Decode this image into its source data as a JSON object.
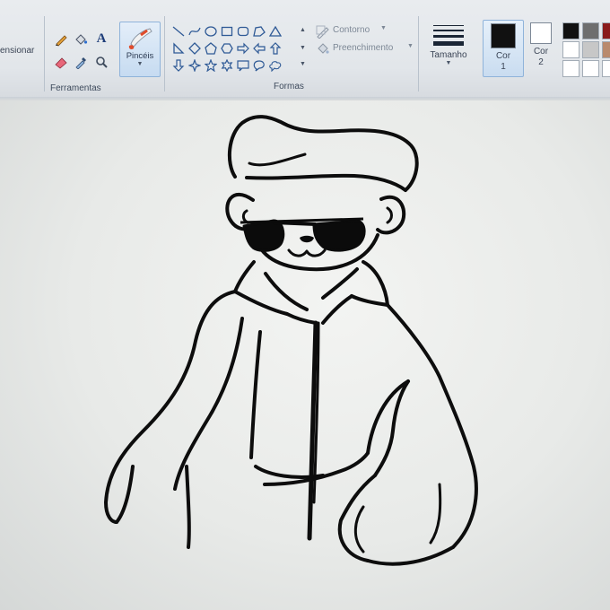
{
  "ribbon": {
    "selection_label": "ensionar",
    "tools_group_label": "Ferramentas",
    "brushes_label": "Pincéis",
    "shapes_group_label": "Formas",
    "outline_label": "Contorno",
    "fill_label": "Preenchimento",
    "size_label": "Tamanho",
    "color1_line1": "Cor",
    "color1_line2": "1",
    "color2_line1": "Cor",
    "color2_line2": "2",
    "text_tool_glyph": "A"
  },
  "colors": {
    "color1": "#111111",
    "color2": "#ffffff",
    "palette_row1": [
      "#111111",
      "#6e6e6e",
      "#8a1b1b"
    ],
    "palette_row2": [
      "#ffffff",
      "#c7c7c7",
      "#b98a6d"
    ],
    "palette_row3": [
      "#ffffff",
      "#ffffff",
      "#ffffff"
    ]
  },
  "icons": {
    "tools": [
      "pencil-icon",
      "fill-bucket-icon",
      "text-icon",
      "eraser-icon",
      "color-picker-icon",
      "magnifier-icon"
    ],
    "shapes": [
      "line-icon",
      "curve-icon",
      "oval-icon",
      "rectangle-icon",
      "rounded-rectangle-icon",
      "polygon-icon",
      "triangle-icon",
      "right-triangle-icon",
      "diamond-icon",
      "pentagon-icon",
      "hexagon-icon",
      "arrow-right-icon",
      "arrow-left-icon",
      "arrow-up-icon",
      "arrow-down-icon",
      "star4-icon",
      "star5-icon",
      "star6-icon",
      "callout-rect-icon",
      "callout-oval-icon",
      "callout-cloud-icon"
    ]
  }
}
